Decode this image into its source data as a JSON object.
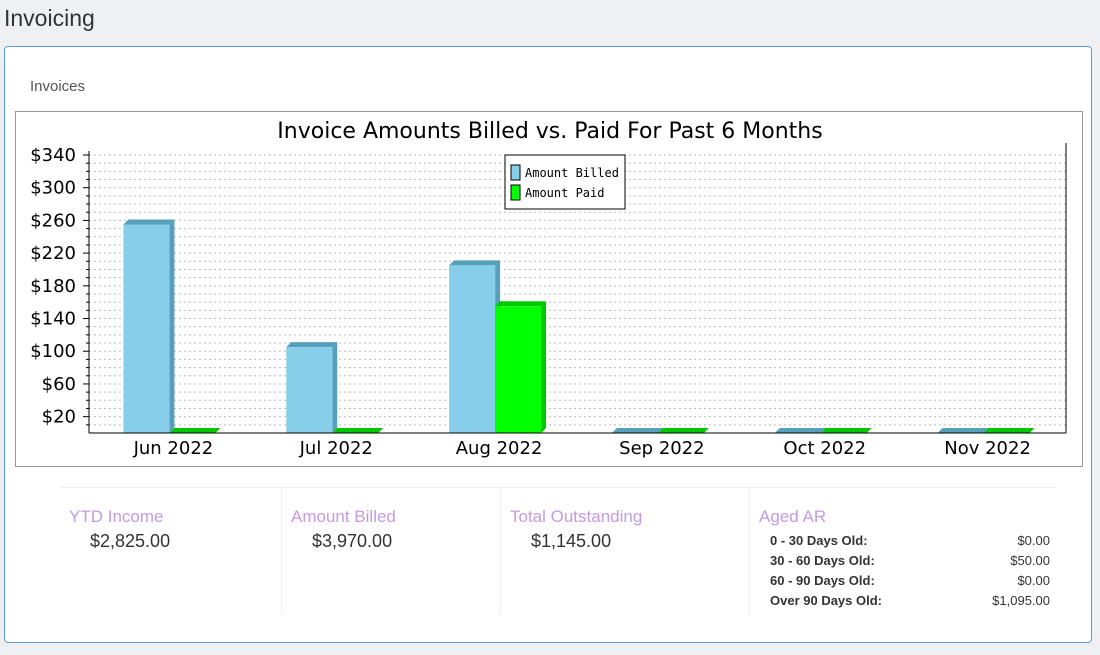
{
  "page": {
    "title": "Invoicing"
  },
  "panel": {
    "heading": "Invoices"
  },
  "colors": {
    "billed": "#87ceeb",
    "billed_dark": "#56a0bb",
    "paid": "#00ff00",
    "paid_dark": "#00c800",
    "label": "#c39be3"
  },
  "chart_data": {
    "type": "bar",
    "title": "Invoice Amounts Billed vs. Paid For Past 6 Months",
    "categories": [
      "Jun 2022",
      "Jul 2022",
      "Aug 2022",
      "Sep 2022",
      "Oct 2022",
      "Nov 2022"
    ],
    "series": [
      {
        "name": "Amount Billed",
        "values": [
          255,
          105,
          205,
          0,
          0,
          0
        ]
      },
      {
        "name": "Amount Paid",
        "values": [
          0,
          0,
          155,
          0,
          0,
          0
        ]
      }
    ],
    "ylim": [
      0,
      340
    ],
    "yticks": [
      20,
      60,
      100,
      140,
      180,
      220,
      260,
      300,
      340
    ],
    "ytick_labels": [
      "$20",
      "$60",
      "$100",
      "$140",
      "$180",
      "$220",
      "$260",
      "$300",
      "$340"
    ],
    "grid": true,
    "legend": "top-center"
  },
  "stats": {
    "ytd_income": {
      "label": "YTD Income",
      "value": "$2,825.00"
    },
    "amount_billed": {
      "label": "Amount Billed",
      "value": "$3,970.00"
    },
    "total_outstanding": {
      "label": "Total Outstanding",
      "value": "$1,145.00"
    },
    "aged_ar": {
      "label": "Aged AR",
      "rows": [
        {
          "label": "0 - 30 Days Old:",
          "value": "$0.00"
        },
        {
          "label": "30 - 60 Days Old:",
          "value": "$50.00"
        },
        {
          "label": "60 - 90 Days Old:",
          "value": "$0.00"
        },
        {
          "label": "Over 90 Days Old:",
          "value": "$1,095.00"
        }
      ]
    }
  }
}
